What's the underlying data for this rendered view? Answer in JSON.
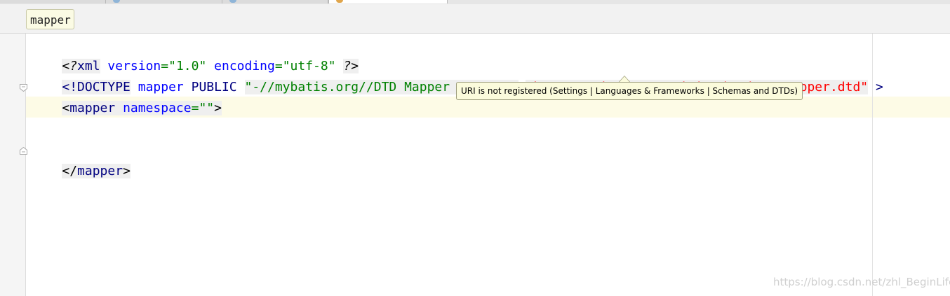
{
  "breadcrumb": {
    "element": "mapper"
  },
  "editor": {
    "line1": {
      "open": "<?",
      "name": "xml",
      "attr1": "version",
      "eq1": "=",
      "val1": "\"1.0\"",
      "attr2": "encoding",
      "eq2": "=",
      "val2": "\"utf-8\"",
      "close": "?>"
    },
    "line2": {
      "open": "<!DOCTYPE",
      "root": "mapper",
      "keyword": "PUBLIC",
      "public_id": "\"-//mybatis.org//DTD Mapper 3.0//EN\"",
      "system_id": "\"http://mybatis.org/dtd/mybatis-3-mapper.dtd\"",
      "close": ">"
    },
    "line3": {
      "open": "<",
      "tag": "mapper",
      "attr": "namespace",
      "eq": "=",
      "val": "\"\"",
      "close": ">"
    },
    "line6": {
      "open": "</",
      "tag": "mapper",
      "close": ">"
    }
  },
  "tooltip": {
    "text": "URI is not registered (Settings | Languages & Frameworks | Schemas and DTDs)"
  },
  "watermark": "https://blog.csdn.net/zhl_BeginLife",
  "colors": {
    "tag": "#000080",
    "attribute": "#0000ff",
    "value": "#008000",
    "unregistered_uri": "#ff0000",
    "caret_line": "#fdfbe6",
    "tooltip_bg": "#fbfbdc"
  }
}
